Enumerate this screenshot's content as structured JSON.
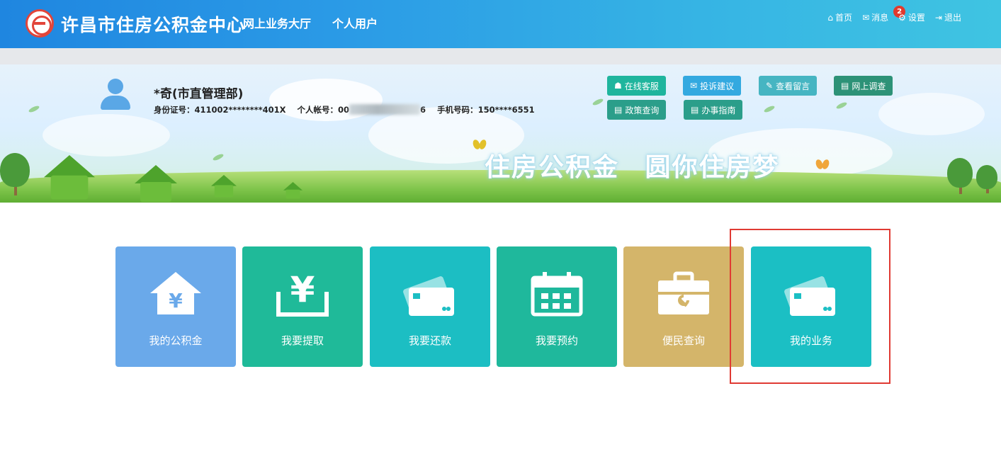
{
  "header": {
    "brand": "许昌市住房公积金中心",
    "nav": [
      "网上业务大厅",
      "个人用户"
    ],
    "links": [
      {
        "label": "首页",
        "icon": "home-icon"
      },
      {
        "label": "消息",
        "icon": "mail-icon",
        "badge": "2"
      },
      {
        "label": "设置",
        "icon": "gear-icon"
      },
      {
        "label": "退出",
        "icon": "logout-icon"
      }
    ]
  },
  "user": {
    "name": "*奇(市直管理部)",
    "id_label": "身份证号：",
    "id_value": "411002********401X",
    "account_label": "个人帐号：",
    "account_prefix": "00",
    "account_suffix": "6",
    "phone_label": "手机号码：",
    "phone_value": "150****6551"
  },
  "quick_buttons": [
    {
      "label": "在线客服",
      "icon": "service-icon"
    },
    {
      "label": "投诉建议",
      "icon": "envelope-icon"
    },
    {
      "label": "查看留言",
      "icon": "message-icon"
    },
    {
      "label": "网上调查",
      "icon": "survey-icon"
    },
    {
      "label": "政策查询",
      "icon": "policy-icon"
    },
    {
      "label": "办事指南",
      "icon": "guide-icon"
    }
  ],
  "banner": {
    "slogan": "住房公积金 圆你住房梦"
  },
  "tiles": [
    {
      "label": "我的公积金",
      "icon": "house-yuan-icon",
      "color": "#6aa9ea"
    },
    {
      "label": "我要提取",
      "icon": "yuan-tray-icon",
      "color": "#1fba99"
    },
    {
      "label": "我要还款",
      "icon": "card-icon",
      "color": "#1cbec3"
    },
    {
      "label": "我要预约",
      "icon": "calendar-icon",
      "color": "#1fb89c"
    },
    {
      "label": "便民查询",
      "icon": "toolbox-icon",
      "color": "#d4b56a"
    },
    {
      "label": "我的业务",
      "icon": "card-icon",
      "color": "#1bbfc4"
    }
  ],
  "highlight_color": "#e03a33"
}
